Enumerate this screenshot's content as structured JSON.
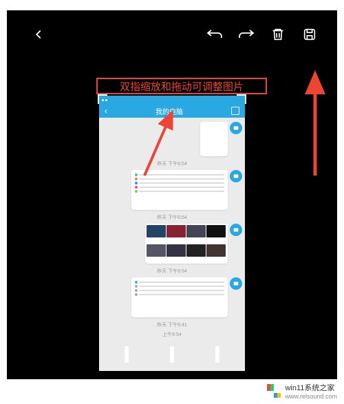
{
  "toolbar": {
    "back": "back",
    "undo": "undo",
    "redo": "redo",
    "delete": "delete",
    "save": "save"
  },
  "hint": "双指缩放和拖动可调整图片",
  "phone": {
    "header_title": "我的电脑",
    "timestamps": [
      "昨天 下午6:54",
      "昨天 下午6:54",
      "昨天 下午6:54",
      "昨天 下午6:41",
      "上午6:54"
    ]
  },
  "watermark": {
    "text1": "win11系统之家",
    "text2": "www.relsound.com"
  }
}
